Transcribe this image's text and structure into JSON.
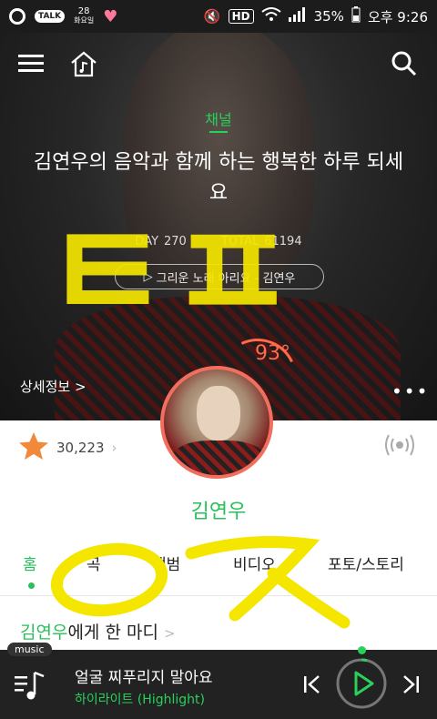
{
  "status_bar": {
    "talk_badge": "TALK",
    "date_num": "28",
    "date_day": "화요일",
    "hd_label": "HD",
    "battery": "35%",
    "time": "오후 9:26"
  },
  "hero": {
    "channel_label": "채널",
    "title": "김연우의 음악과 함께 하는 행복한 하루 되세요",
    "today_label": "DAY",
    "today_value": "270",
    "total_label": "TOTAL",
    "total_value": "61194",
    "song_pill": "그리운 노래 아리요 - 김연우",
    "temperature": "93°",
    "detail_link": "상세정보 >",
    "more_dots": "•••",
    "handwritten_overlay": "ㅌㅍ"
  },
  "profile": {
    "fan_count": "30,223",
    "artist_name": "김연우"
  },
  "tabs": [
    {
      "label": "홈"
    },
    {
      "label": "곡"
    },
    {
      "label": "앨범"
    },
    {
      "label": "비디오"
    },
    {
      "label": "포토/스토리"
    }
  ],
  "comment": {
    "name": "김연우",
    "text": "에게 한 마디",
    "arrow": ">"
  },
  "player": {
    "tag": "music",
    "song_title": "얼굴 찌푸리지 말아요",
    "song_subtitle": "하이라이트 (Highlight)"
  },
  "colors": {
    "accent": "#29c05a",
    "temp": "#ff6b4a",
    "annotation": "#f5e600"
  }
}
